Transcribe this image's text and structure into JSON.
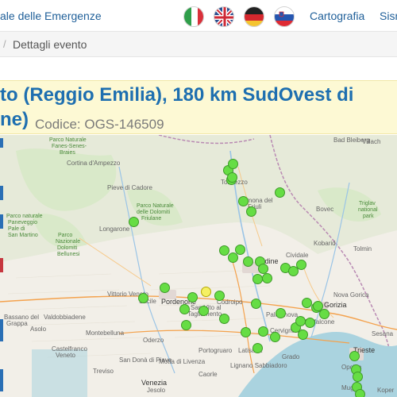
{
  "header": {
    "site_title": "ale delle Emergenze",
    "languages": [
      {
        "name": "Italiano",
        "icon": "italy-flag-icon"
      },
      {
        "name": "English",
        "icon": "uk-flag-icon"
      },
      {
        "name": "Deutsch",
        "icon": "germany-flag-icon"
      },
      {
        "name": "Slovenščina",
        "icon": "slovenia-flag-icon"
      }
    ],
    "nav": [
      "Cartografia",
      "Sisn"
    ]
  },
  "breadcrumb": {
    "current": "Dettagli evento"
  },
  "event": {
    "title_line1": "to (Reggio Emilia), 180 km SudOvest di",
    "title_line2": "ne)",
    "code": "Codice: OGS-146509"
  },
  "map": {
    "labels": [
      {
        "t": "Parco Naturale",
        "c": "green"
      },
      {
        "t": "Fanes-Senes-",
        "c": "green"
      },
      {
        "t": "Braies",
        "c": "green"
      },
      {
        "t": "Cortina d'Ampezzo",
        "c": ""
      },
      {
        "t": "Pieve di Cadore",
        "c": ""
      },
      {
        "t": "Parco Naturale",
        "c": "green"
      },
      {
        "t": "delle Dolomiti",
        "c": "green"
      },
      {
        "t": "Friulane",
        "c": "green"
      },
      {
        "t": "Longarone",
        "c": ""
      },
      {
        "t": "Parco naturale",
        "c": "green"
      },
      {
        "t": "Paneveggio",
        "c": "green"
      },
      {
        "t": "Pale di",
        "c": "green"
      },
      {
        "t": "San Martino",
        "c": "green"
      },
      {
        "t": "Parco",
        "c": "green"
      },
      {
        "t": "Nazionale",
        "c": "green"
      },
      {
        "t": "Dolomiti",
        "c": "green"
      },
      {
        "t": "Bellunesi",
        "c": "green"
      },
      {
        "t": "Vittorio Veneto",
        "c": ""
      },
      {
        "t": "Sacile",
        "c": ""
      },
      {
        "t": "Pordenone",
        "c": "city"
      },
      {
        "t": "San Vito al",
        "c": ""
      },
      {
        "t": "Tagliamento",
        "c": ""
      },
      {
        "t": "Codroipo",
        "c": ""
      },
      {
        "t": "Treviso",
        "c": ""
      },
      {
        "t": "Castelfranco",
        "c": ""
      },
      {
        "t": "Veneto",
        "c": ""
      },
      {
        "t": "Bassano del",
        "c": ""
      },
      {
        "t": "Grappa",
        "c": ""
      },
      {
        "t": "Valdobbiadene",
        "c": ""
      },
      {
        "t": "Montebelluna",
        "c": ""
      },
      {
        "t": "Asolo",
        "c": ""
      },
      {
        "t": "Oderzo",
        "c": ""
      },
      {
        "t": "Motta di Livenza",
        "c": ""
      },
      {
        "t": "Portogruaro",
        "c": ""
      },
      {
        "t": "Latisana",
        "c": ""
      },
      {
        "t": "Lignano Sabbiadoro",
        "c": ""
      },
      {
        "t": "Caorle",
        "c": ""
      },
      {
        "t": "Jesolo",
        "c": ""
      },
      {
        "t": "San Donà di Piave",
        "c": ""
      },
      {
        "t": "Palmanova",
        "c": ""
      },
      {
        "t": "Cervignano",
        "c": ""
      },
      {
        "t": "Udine",
        "c": "city"
      },
      {
        "t": "Tolmezzo",
        "c": ""
      },
      {
        "t": "Gemona del",
        "c": ""
      },
      {
        "t": "Friuli",
        "c": ""
      },
      {
        "t": "Cividale",
        "c": ""
      },
      {
        "t": "Gorizia",
        "c": "city"
      },
      {
        "t": "Monfalcone",
        "c": ""
      },
      {
        "t": "Trieste",
        "c": "city"
      },
      {
        "t": "Opcina",
        "c": ""
      },
      {
        "t": "Muggia",
        "c": ""
      },
      {
        "t": "Koper",
        "c": ""
      },
      {
        "t": "Villach",
        "c": ""
      },
      {
        "t": "Bad Bleiberg",
        "c": ""
      },
      {
        "t": "Triglav",
        "c": "green"
      },
      {
        "t": "national",
        "c": "green"
      },
      {
        "t": "park",
        "c": "green"
      },
      {
        "t": "Tolmin",
        "c": ""
      },
      {
        "t": "Bovec",
        "c": ""
      },
      {
        "t": "Kobarid",
        "c": ""
      },
      {
        "t": "Nova Gorica",
        "c": ""
      },
      {
        "t": "Sesana",
        "c": ""
      },
      {
        "t": "Grado",
        "c": ""
      },
      {
        "t": "Venezia",
        "c": "city"
      }
    ],
    "stations": [
      {
        "id": "s1"
      },
      {
        "id": "s2"
      },
      {
        "id": "s3"
      },
      {
        "id": "s4"
      },
      {
        "id": "s5"
      },
      {
        "id": "s6"
      },
      {
        "id": "s7"
      },
      {
        "id": "s8"
      },
      {
        "id": "s9"
      },
      {
        "id": "s10"
      },
      {
        "id": "s11"
      },
      {
        "id": "s12"
      },
      {
        "id": "s13"
      },
      {
        "id": "s14"
      },
      {
        "id": "s15"
      },
      {
        "id": "s16"
      },
      {
        "id": "s17"
      },
      {
        "id": "s18"
      },
      {
        "id": "s19"
      },
      {
        "id": "s20"
      },
      {
        "id": "s21"
      },
      {
        "id": "s22"
      },
      {
        "id": "s23"
      },
      {
        "id": "s24"
      },
      {
        "id": "s25"
      },
      {
        "id": "s26"
      },
      {
        "id": "s27"
      },
      {
        "id": "s28"
      },
      {
        "id": "s29"
      },
      {
        "id": "s30"
      },
      {
        "id": "s31"
      },
      {
        "id": "s32"
      },
      {
        "id": "s33"
      },
      {
        "id": "s34"
      },
      {
        "id": "s35"
      },
      {
        "id": "s36"
      },
      {
        "id": "s37"
      },
      {
        "id": "s38"
      },
      {
        "id": "s39"
      },
      {
        "id": "s40"
      },
      {
        "id": "s41"
      },
      {
        "id": "s42",
        "selected": true
      },
      {
        "id": "s43"
      },
      {
        "id": "s44"
      },
      {
        "id": "s45"
      },
      {
        "id": "s46"
      },
      {
        "id": "s47"
      }
    ]
  },
  "colors": {
    "accent": "#1e6fb0",
    "banner_bg": "#fdf9d4",
    "station": "#66dd44",
    "station_selected": "#f5f063"
  }
}
